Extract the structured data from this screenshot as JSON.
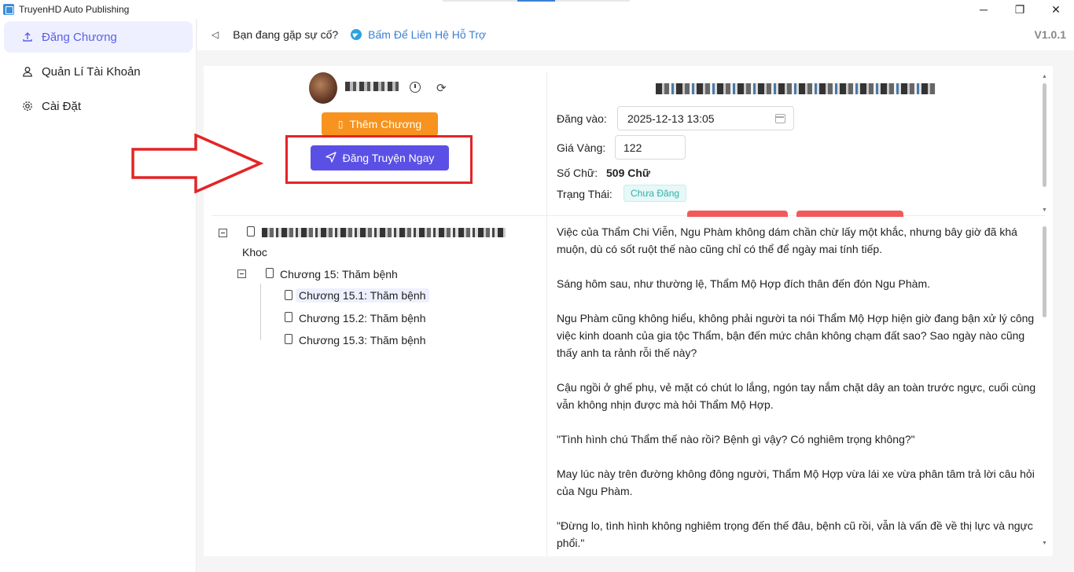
{
  "window": {
    "title": "TruyenHD Auto Publishing",
    "controls": {
      "minimize": "─",
      "maximize": "❐",
      "close": "✕"
    }
  },
  "sidebar": {
    "items": [
      {
        "label": "Đăng Chương",
        "icon": "upload-icon",
        "active": true
      },
      {
        "label": "Quản Lí Tài Khoản",
        "icon": "user-icon",
        "active": false
      },
      {
        "label": "Cài Đặt",
        "icon": "gear-icon",
        "active": false
      }
    ]
  },
  "header": {
    "issue_text": "Bạn đang gặp sự cố?",
    "support_link": "Bấm Để Liên Hệ Hỗ Trợ",
    "version": "V1.0.1"
  },
  "actions": {
    "add_chapter": "Thêm Chương",
    "publish_now": "Đăng Truyện Ngay"
  },
  "form": {
    "publish_at_label": "Đăng vào:",
    "publish_at_value": "2025-12-13 13:05",
    "gold_price_label": "Giá Vàng:",
    "gold_price_value": "122",
    "word_count_label": "Số Chữ:",
    "word_count_value": "509 Chữ",
    "status_label": "Trạng Thái:",
    "status_value": "Chưa Đăng"
  },
  "tree": {
    "root_suffix": "Khoc",
    "chapter": "Chương 15: Thăm bệnh",
    "parts": [
      {
        "label": "Chương 15.1: Thăm bệnh",
        "selected": true
      },
      {
        "label": "Chương 15.2: Thăm bệnh",
        "selected": false
      },
      {
        "label": "Chương 15.3: Thăm bệnh",
        "selected": false
      }
    ]
  },
  "content": {
    "paragraphs": [
      "Việc của Thẩm Chi Viễn, Ngu Phàm không dám chần chừ lấy một khắc, nhưng bây giờ đã khá muộn, dù có sốt ruột thế nào cũng chỉ có thể để ngày mai tính tiếp.",
      "Sáng hôm sau, như thường lệ, Thẩm Mộ Hợp đích thân đến đón Ngu Phàm.",
      "Ngu Phàm cũng không hiểu, không phải người ta nói Thẩm Mộ Hợp hiện giờ đang bận xử lý công việc kinh doanh của gia tộc Thẩm, bận đến mức chân không chạm đất sao? Sao ngày nào cũng thấy anh ta rảnh rỗi thế này?",
      "Cậu ngồi ở ghế phụ, vẻ mặt có chút lo lắng, ngón tay nắm chặt dây an toàn trước ngực, cuối cùng vẫn không nhịn được mà hỏi Thẩm Mộ Hợp.",
      "\"Tình hình chú Thẩm thế nào rồi? Bệnh gì vậy? Có nghiêm trọng không?\"",
      "May lúc này trên đường không đông người, Thẩm Mộ Hợp vừa lái xe vừa phân tâm trả lời câu hỏi của Ngu Phàm.",
      "\"Đừng lo, tình hình không nghiêm trọng đến thế đâu, bệnh cũ rồi, vẫn là vấn đề về thị lực và ngực phổi.\""
    ]
  },
  "colors": {
    "accent": "#5b50e6",
    "orange": "#f7931e",
    "highlight_red": "#e42426",
    "status_teal": "#2fb0a8"
  }
}
